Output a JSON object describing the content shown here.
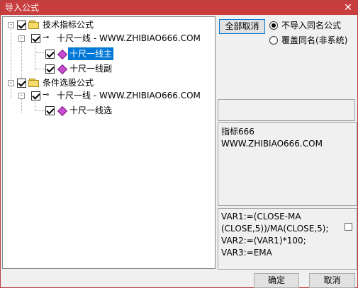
{
  "window": {
    "title": "导入公式",
    "close_glyph": "✕"
  },
  "tree": {
    "root1": {
      "label": "技术指标公式"
    },
    "root1_child": {
      "label": "十尺一线 - WWW.ZHIBIAO666.COM"
    },
    "root1_leaf1": {
      "label": "十尺一线主"
    },
    "root1_leaf2": {
      "label": "十尺一线副"
    },
    "root2": {
      "label": "条件选股公式"
    },
    "root2_child": {
      "label": "十尺一线 - WWW.ZHIBIAO666.COM"
    },
    "root2_leaf1": {
      "label": "十尺一线选"
    },
    "expander_glyph": "-",
    "key_glyph": "⊸"
  },
  "options": {
    "deselect_all_label": "全部取消",
    "radio1_label": "不导入同名公式",
    "radio2_label": "覆盖同名(非系统)"
  },
  "info": {
    "line1": "指标666",
    "line2": "WWW.ZHIBIAO666.COM"
  },
  "code": {
    "line1": "VAR1:=(CLOSE-MA",
    "line2": "(CLOSE,5))/MA(CLOSE,5);",
    "line3": "VAR2:=(VAR1)*100;",
    "line4": "VAR3:=EMA"
  },
  "buttons": {
    "ok_label": "确定",
    "cancel_label": "取消"
  },
  "colors": {
    "titlebar": "#c83d3e",
    "selection": "#0078d7",
    "leaf_icon": "#c64bd1"
  }
}
